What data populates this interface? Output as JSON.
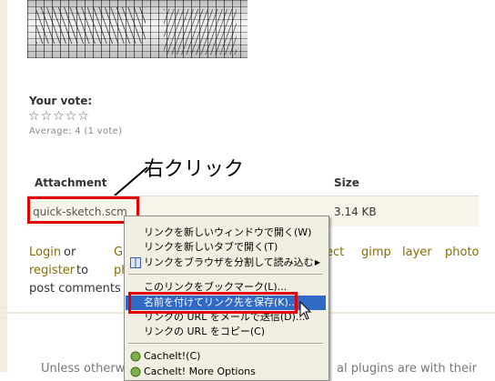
{
  "vote": {
    "title": "Your vote:",
    "stars": "☆☆☆☆☆",
    "average": "Average: 4 (1 vote)"
  },
  "annotation": {
    "label": "右クリック"
  },
  "table": {
    "headers": [
      "Attachment",
      "Size"
    ],
    "rows": [
      {
        "file": "quick-sketch.scm",
        "size": "3.14 KB"
      }
    ]
  },
  "links": {
    "login": "Login",
    "or": "or",
    "register": "register",
    "to": "to",
    "post_comments": "post comments",
    "g_fragment": "Gl",
    "ph_fragment": "ph"
  },
  "tags": [
    "ect",
    "gimp",
    "layer",
    "photo"
  ],
  "footer": {
    "text_left": "Unless otherw",
    "text_right": "al plugins are with their"
  },
  "context_menu": {
    "items": [
      {
        "label": "リンクを新しいウィンドウで開く(W)"
      },
      {
        "label": "リンクを新しいタブで開く(T)"
      },
      {
        "label": "リンクをブラウザを分割して読み込む",
        "submenu": "▶"
      },
      {
        "label": "このリンクをブックマーク(L)..."
      },
      {
        "label": "名前を付けてリンク先を保存(K)...",
        "highlighted": true
      },
      {
        "label": "リンクの URL をメールで送信(D)..."
      },
      {
        "label": "リンクの URL をコピー(C)"
      },
      {
        "label": "CacheIt!(C)"
      },
      {
        "label": "CacheIt! More Options"
      }
    ]
  },
  "colors": {
    "highlight": "#316ac5",
    "annotation_red": "#e30000",
    "link": "#8a6d00"
  }
}
